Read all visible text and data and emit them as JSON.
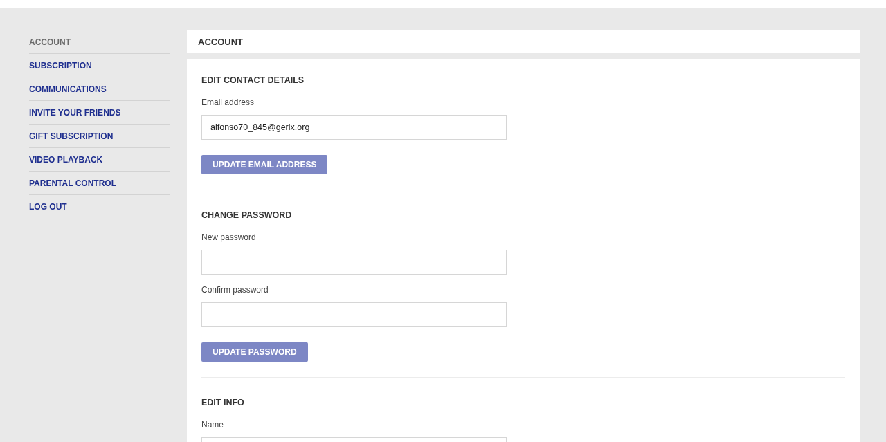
{
  "sidebar": {
    "items": [
      {
        "label": "ACCOUNT",
        "selected": true
      },
      {
        "label": "SUBSCRIPTION",
        "selected": false
      },
      {
        "label": "COMMUNICATIONS",
        "selected": false
      },
      {
        "label": "INVITE YOUR FRIENDS",
        "selected": false
      },
      {
        "label": "GIFT SUBSCRIPTION",
        "selected": false
      },
      {
        "label": "VIDEO PLAYBACK",
        "selected": false
      },
      {
        "label": "PARENTAL CONTROL",
        "selected": false
      },
      {
        "label": "LOG OUT",
        "selected": false
      }
    ]
  },
  "main": {
    "title": "ACCOUNT",
    "sections": [
      {
        "title": "EDIT CONTACT DETAILS",
        "fields": [
          {
            "label": "Email address",
            "value": "alfonso70_845@gerix.org"
          }
        ],
        "button": "UPDATE EMAIL ADDRESS"
      },
      {
        "title": "CHANGE PASSWORD",
        "fields": [
          {
            "label": "New password"
          },
          {
            "label": "Confirm password"
          }
        ],
        "button": "UPDATE PASSWORD"
      },
      {
        "title": "EDIT INFO",
        "fields": [
          {
            "label": "Name"
          }
        ]
      }
    ]
  }
}
